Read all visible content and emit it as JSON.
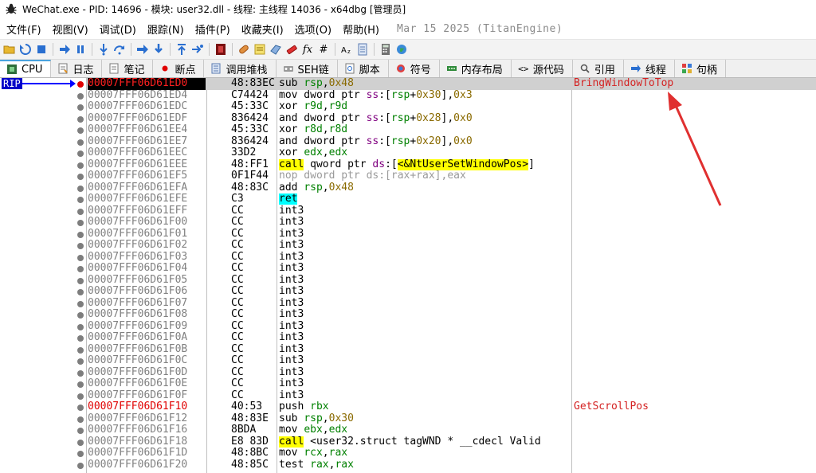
{
  "window": {
    "title": "WeChat.exe - PID: 14696 - 模块: user32.dll - 线程: 主线程 14036 - x64dbg [管理员]"
  },
  "menu": {
    "items": [
      "文件(F)",
      "视图(V)",
      "调试(D)",
      "跟踪(N)",
      "插件(P)",
      "收藏夹(I)",
      "选项(O)",
      "帮助(H)"
    ],
    "build_date": "Mar 15 2025 (TitanEngine)"
  },
  "toolbar": {
    "icons": [
      "open-icon",
      "restart-icon",
      "stop-icon",
      "run-icon",
      "pause-icon",
      "step-into-icon",
      "step-over-icon",
      "trace-into-icon",
      "trace-over-icon",
      "execute-till-return-icon",
      "run-to-user-code-icon",
      "scylla-icon",
      "patch-icon",
      "comment-icon",
      "label-icon",
      "bookmark-icon",
      "function-icon",
      "hash-icon",
      "font-icon",
      "strings-icon",
      "calculator-icon",
      "globe-icon"
    ],
    "fx_label": "fx",
    "hash_label": "#"
  },
  "tabs": [
    {
      "label": "CPU",
      "icon": "cpu-icon",
      "active": true
    },
    {
      "label": "日志",
      "icon": "log-icon"
    },
    {
      "label": "笔记",
      "icon": "notes-icon"
    },
    {
      "label": "断点",
      "icon": "breakpoint-icon"
    },
    {
      "label": "调用堆栈",
      "icon": "callstack-icon"
    },
    {
      "label": "SEH链",
      "icon": "seh-icon"
    },
    {
      "label": "脚本",
      "icon": "script-icon"
    },
    {
      "label": "符号",
      "icon": "symbols-icon"
    },
    {
      "label": "内存布局",
      "icon": "memory-icon"
    },
    {
      "label": "源代码",
      "icon": "source-icon"
    },
    {
      "label": "引用",
      "icon": "references-icon"
    },
    {
      "label": "线程",
      "icon": "threads-icon"
    },
    {
      "label": "句柄",
      "icon": "handles-icon"
    }
  ],
  "rip_label": "RIP",
  "rows": [
    {
      "addr": "00007FFF06D61ED0",
      "bytes": "48:83EC",
      "instr": "sub rsp,0x48",
      "comment": "BringWindowToTop",
      "current": true
    },
    {
      "addr": "00007FFF06D61ED4",
      "bytes": "C74424",
      "instr": "mov dword ptr ss:[rsp+0x30],0x3"
    },
    {
      "addr": "00007FFF06D61EDC",
      "bytes": "45:33C",
      "instr": "xor r9d,r9d"
    },
    {
      "addr": "00007FFF06D61EDF",
      "bytes": "836424",
      "instr": "and dword ptr ss:[rsp+0x28],0x0"
    },
    {
      "addr": "00007FFF06D61EE4",
      "bytes": "45:33C",
      "instr": "xor r8d,r8d"
    },
    {
      "addr": "00007FFF06D61EE7",
      "bytes": "836424",
      "instr": "and dword ptr ss:[rsp+0x20],0x0"
    },
    {
      "addr": "00007FFF06D61EEC",
      "bytes": "33D2",
      "instr": "xor edx,edx"
    },
    {
      "addr": "00007FFF06D61EEE",
      "bytes": "48:FF1",
      "instr": "call qword ptr ds:[<&NtUserSetWindowPos>]"
    },
    {
      "addr": "00007FFF06D61EF5",
      "bytes": "0F1F44",
      "instr": "nop dword ptr ds:[rax+rax],eax"
    },
    {
      "addr": "00007FFF06D61EFA",
      "bytes": "48:83C",
      "instr": "add rsp,0x48"
    },
    {
      "addr": "00007FFF06D61EFE",
      "bytes": "C3",
      "instr": "ret"
    },
    {
      "addr": "00007FFF06D61EFF",
      "bytes": "CC",
      "instr": "int3"
    },
    {
      "addr": "00007FFF06D61F00",
      "bytes": "CC",
      "instr": "int3"
    },
    {
      "addr": "00007FFF06D61F01",
      "bytes": "CC",
      "instr": "int3"
    },
    {
      "addr": "00007FFF06D61F02",
      "bytes": "CC",
      "instr": "int3"
    },
    {
      "addr": "00007FFF06D61F03",
      "bytes": "CC",
      "instr": "int3"
    },
    {
      "addr": "00007FFF06D61F04",
      "bytes": "CC",
      "instr": "int3"
    },
    {
      "addr": "00007FFF06D61F05",
      "bytes": "CC",
      "instr": "int3"
    },
    {
      "addr": "00007FFF06D61F06",
      "bytes": "CC",
      "instr": "int3"
    },
    {
      "addr": "00007FFF06D61F07",
      "bytes": "CC",
      "instr": "int3"
    },
    {
      "addr": "00007FFF06D61F08",
      "bytes": "CC",
      "instr": "int3"
    },
    {
      "addr": "00007FFF06D61F09",
      "bytes": "CC",
      "instr": "int3"
    },
    {
      "addr": "00007FFF06D61F0A",
      "bytes": "CC",
      "instr": "int3"
    },
    {
      "addr": "00007FFF06D61F0B",
      "bytes": "CC",
      "instr": "int3"
    },
    {
      "addr": "00007FFF06D61F0C",
      "bytes": "CC",
      "instr": "int3"
    },
    {
      "addr": "00007FFF06D61F0D",
      "bytes": "CC",
      "instr": "int3"
    },
    {
      "addr": "00007FFF06D61F0E",
      "bytes": "CC",
      "instr": "int3"
    },
    {
      "addr": "00007FFF06D61F0F",
      "bytes": "CC",
      "instr": "int3"
    },
    {
      "addr": "00007FFF06D61F10",
      "bytes": "40:53",
      "instr": "push rbx",
      "comment": "GetScrollPos",
      "func_start": true
    },
    {
      "addr": "00007FFF06D61F12",
      "bytes": "48:83E",
      "instr": "sub rsp,0x30"
    },
    {
      "addr": "00007FFF06D61F16",
      "bytes": "8BDA",
      "instr": "mov ebx,edx"
    },
    {
      "addr": "00007FFF06D61F18",
      "bytes": "E8 83D",
      "instr": "call <user32.struct tagWND * __cdecl Valid"
    },
    {
      "addr": "00007FFF06D61F1D",
      "bytes": "48:8BC",
      "instr": "mov rcx,rax"
    },
    {
      "addr": "00007FFF06D61F20",
      "bytes": "48:85C",
      "instr": "test rax,rax"
    }
  ],
  "colors": {
    "rip_bg": "#0000c8",
    "current_row": "#d0d0d0",
    "comment": "#d42222",
    "register": "#008000",
    "call_highlight": "#ffff00",
    "ret_highlight": "#00ffff",
    "annotation_arrow": "#e03030"
  }
}
